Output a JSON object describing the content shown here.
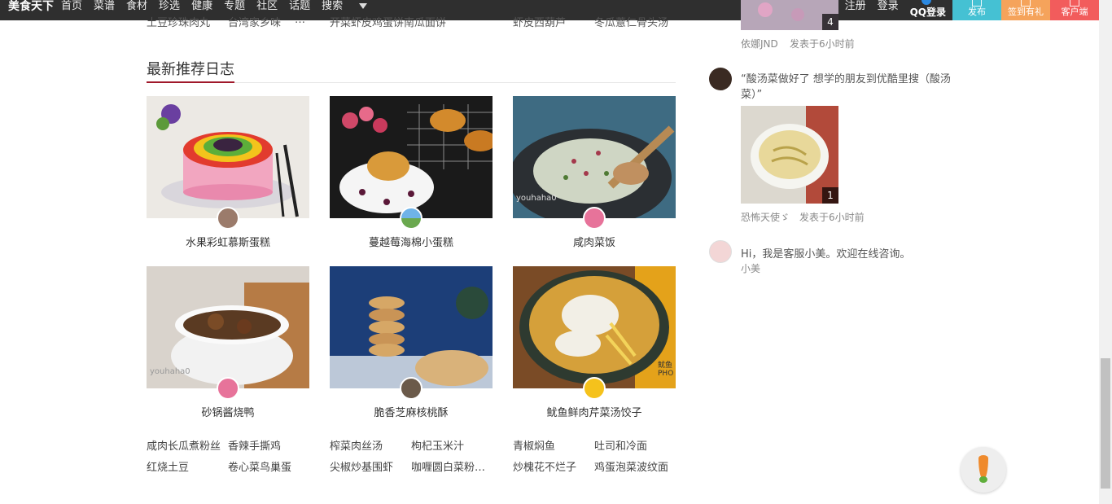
{
  "topbar": {
    "logo": "美食天下",
    "nav": [
      "首页",
      "菜谱",
      "食材",
      "珍选",
      "健康",
      "专题",
      "社区",
      "话题",
      "搜索"
    ],
    "register": "注册",
    "login": "登录",
    "qq_login": "QQ登录",
    "publish": "发布",
    "checkin": "签到有礼",
    "client": "客户端"
  },
  "cutoff_row": [
    "土豆珍珠肉丸",
    "台湾家乡味",
    "…",
    "开菜虾皮鸡蛋饼南瓜面饼",
    "虾皮西葫芦",
    "冬瓜薏仁骨头汤"
  ],
  "section": {
    "title": "最新推荐日志",
    "cards": [
      {
        "name": "水果彩虹慕斯蛋糕"
      },
      {
        "name": "蔓越莓海棉小蛋糕"
      },
      {
        "name": "咸肉菜饭"
      },
      {
        "name": "砂锅酱烧鸭"
      },
      {
        "name": "脆香芝麻核桃酥"
      },
      {
        "name": "鱿鱼鲜肉芹菜汤饺子"
      }
    ],
    "links": [
      [
        "咸肉长瓜煮粉丝",
        "香辣手撕鸡",
        "榨菜肉丝汤",
        "枸杞玉米汁",
        "青椒焖鱼",
        "吐司和冷面"
      ],
      [
        "红烧土豆",
        "卷心菜鸟巢蛋",
        "尖椒炒基围虾",
        "咖喱圆白菜粉…",
        "炒槐花不烂子",
        "鸡蛋泡菜波纹面"
      ]
    ]
  },
  "feed": [
    {
      "count": "4",
      "user": "依娜JND",
      "time": "发表于6小时前"
    },
    {
      "text": "“酸汤菜做好了 想学的朋友到优酷里搜（酸汤菜）”",
      "count": "1",
      "user": "恐怖天使ゞ",
      "time": "发表于6小时前"
    },
    {
      "text": "Hi，我是客服小美。欢迎在线咨询。",
      "user": "小美"
    }
  ],
  "colors": {
    "accent": "#a0182a",
    "publish": "#45c1d3",
    "checkin": "#f5a35b",
    "client": "#f25c5c"
  }
}
